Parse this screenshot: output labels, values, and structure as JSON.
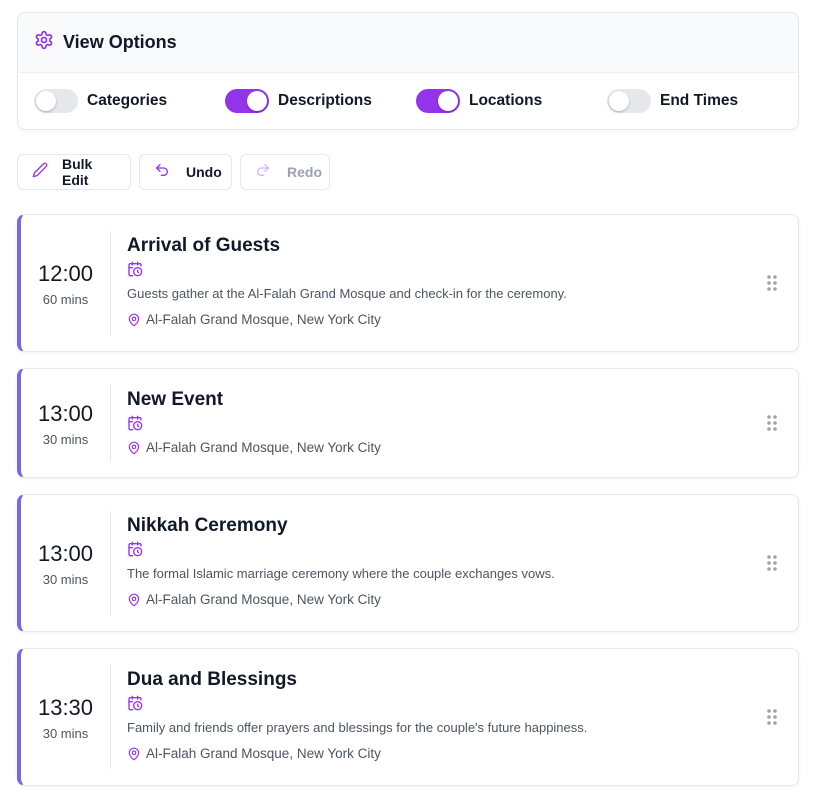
{
  "view_options": {
    "title": "View Options",
    "toggles": [
      {
        "label": "Categories",
        "on": false
      },
      {
        "label": "Descriptions",
        "on": true
      },
      {
        "label": "Locations",
        "on": true
      },
      {
        "label": "End Times",
        "on": false
      }
    ]
  },
  "toolbar": {
    "bulk_edit": "Bulk Edit",
    "undo": "Undo",
    "redo": "Redo"
  },
  "events": [
    {
      "time": "12:00",
      "duration": "60 mins",
      "title": "Arrival of Guests",
      "description": "Guests gather at the Al-Falah Grand Mosque and check-in for the ceremony.",
      "location": "Al-Falah Grand Mosque, New York City"
    },
    {
      "time": "13:00",
      "duration": "30 mins",
      "title": "New Event",
      "description": "",
      "location": "Al-Falah Grand Mosque, New York City"
    },
    {
      "time": "13:00",
      "duration": "30 mins",
      "title": "Nikkah Ceremony",
      "description": "The formal Islamic marriage ceremony where the couple exchanges vows.",
      "location": "Al-Falah Grand Mosque, New York City"
    },
    {
      "time": "13:30",
      "duration": "30 mins",
      "title": "Dua and Blessings",
      "description": "Family and friends offer prayers and blessings for the couple's future happiness.",
      "location": "Al-Falah Grand Mosque, New York City"
    }
  ],
  "colors": {
    "accent": "#9333ea",
    "card_border_left": "#7c68e0",
    "icon": "#9333ea"
  }
}
